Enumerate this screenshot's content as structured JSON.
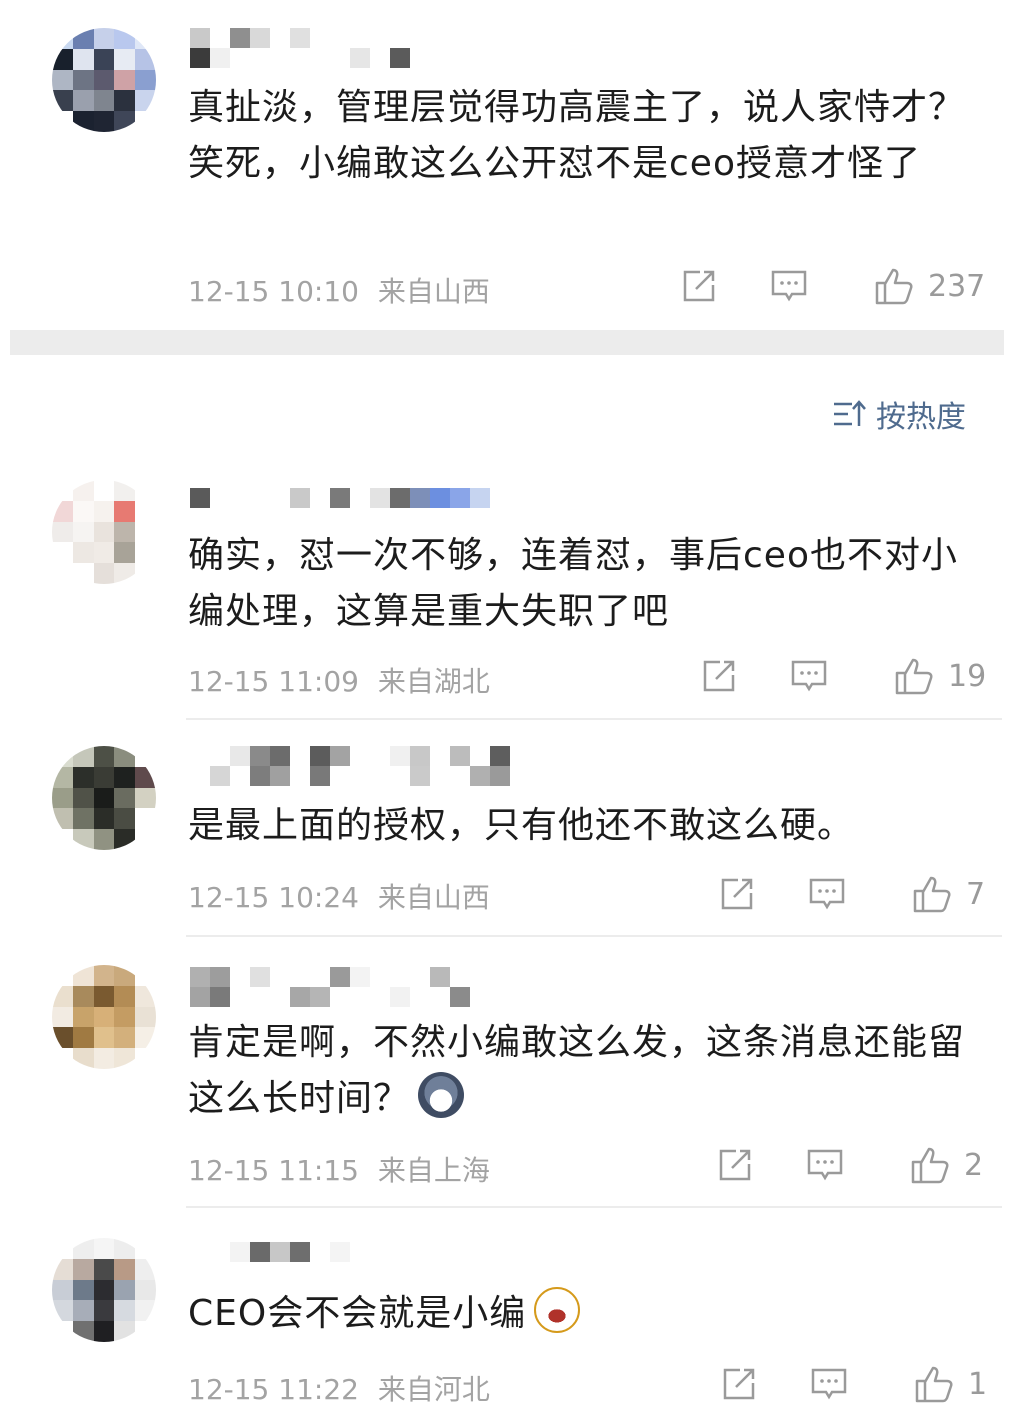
{
  "sort": {
    "label": "按热度"
  },
  "comments": [
    {
      "text": "真扯淡，管理层觉得功高震主了，说人家恃才？笑死，小编敢这么公开怼不是ceo授意才怪了",
      "time": "12-15 10:10",
      "location": "来自山西",
      "likes": "237"
    },
    {
      "text": "确实，怼一次不够，连着怼，事后ceo也不对小编处理，这算是重大失职了吧",
      "time": "12-15 11:09",
      "location": "来自湖北",
      "likes": "19"
    },
    {
      "text": "是最上面的授权，只有他还不敢这么硬。",
      "time": "12-15 10:24",
      "location": "来自山西",
      "likes": "7"
    },
    {
      "text": "肯定是啊，不然小编敢这么发，这条消息还能留这么长时间？",
      "time": "12-15 11:15",
      "location": "来自上海",
      "likes": "2"
    },
    {
      "text": "CEO会不会就是小编",
      "time": "12-15 11:22",
      "location": "来自河北",
      "likes": "1"
    }
  ],
  "icons": {
    "repost": "share-edit-icon",
    "comment": "comment-icon",
    "like": "thumbs-up-icon",
    "sort": "sort-icon",
    "emoji_husky": "husky-emoji-icon",
    "emoji_laugh": "laugh-emoji-icon"
  },
  "colors": {
    "link": "#4f6b8e",
    "meta": "#a3a3a3",
    "divider": "#ececec"
  }
}
